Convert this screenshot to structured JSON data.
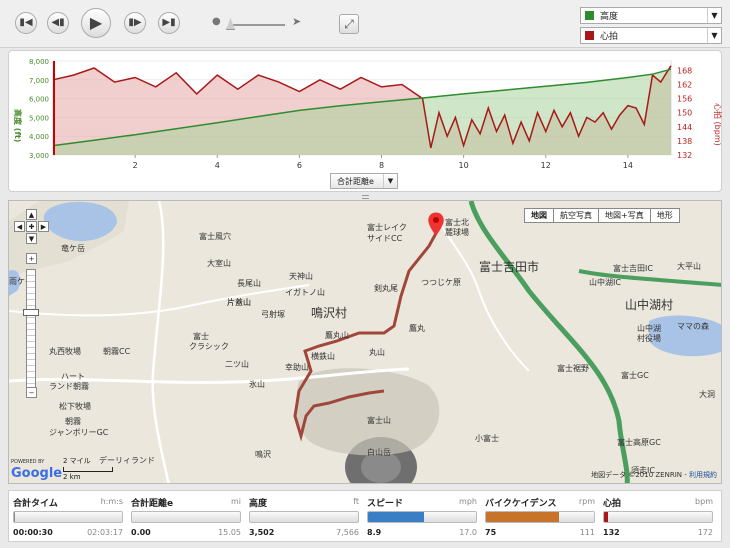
{
  "selectors": {
    "top": {
      "label": "高度",
      "color": "#2e8b2e"
    },
    "bottom": {
      "label": "心拍",
      "color": "#a81818"
    }
  },
  "chart": {
    "distance_selector": "合計距離e",
    "left_axis_label": "高度 (ft)",
    "right_axis_label": "心拍 (bpm)"
  },
  "chart_data": {
    "type": "area",
    "x_ticks": [
      "2",
      "4",
      "6",
      "8",
      "10",
      "12",
      "14"
    ],
    "xlim": [
      0,
      15.05
    ],
    "left_ticks": [
      "8,000",
      "7,000",
      "6,000",
      "5,000",
      "4,000",
      "3,000"
    ],
    "left_ylim": [
      3000,
      8000
    ],
    "right_ticks": [
      "168",
      "162",
      "156",
      "150",
      "144",
      "138",
      "132"
    ],
    "right_ylim": [
      132,
      172
    ],
    "series": [
      {
        "name": "高度",
        "color": "#2e8b2e",
        "x": [
          0,
          1,
          2,
          3,
          4,
          5,
          6,
          7,
          8,
          9,
          10,
          11,
          12,
          13,
          14,
          14.6,
          15.05
        ],
        "values": [
          3502,
          3780,
          4080,
          4400,
          4720,
          5050,
          5370,
          5620,
          5830,
          6030,
          6250,
          6450,
          6660,
          6860,
          7120,
          7300,
          7566
        ]
      },
      {
        "name": "心拍",
        "color": "#a81818",
        "x": [
          0,
          0.5,
          1,
          1.5,
          2,
          2.5,
          3,
          3.5,
          4,
          4.5,
          5,
          5.5,
          6,
          6.5,
          7,
          7.5,
          8,
          8.5,
          9,
          9.2,
          9.4,
          9.6,
          9.8,
          10,
          10.2,
          10.4,
          10.6,
          10.8,
          11,
          11.2,
          11.4,
          11.6,
          11.8,
          12,
          12.2,
          12.4,
          12.6,
          12.8,
          13,
          13.2,
          13.4,
          13.6,
          13.8,
          14,
          14.2,
          14.4,
          14.6,
          14.8,
          15.05
        ],
        "values": [
          164,
          166,
          169,
          163,
          165,
          161,
          167,
          158,
          166,
          160,
          166,
          163,
          159,
          164,
          160,
          165,
          161,
          162,
          156,
          135,
          150,
          140,
          148,
          136,
          147,
          141,
          152,
          142,
          149,
          137,
          146,
          138,
          150,
          142,
          151,
          144,
          150,
          140,
          148,
          146,
          150,
          143,
          149,
          153,
          152,
          145,
          166,
          163,
          170
        ]
      }
    ]
  },
  "map": {
    "types": [
      "地図",
      "航空写真",
      "地図+写真",
      "地形"
    ],
    "big_labels": [
      "鳴沢村",
      "富士吉田市",
      "山中湖村"
    ],
    "labels": [
      "竜ケ岳",
      "雨ケ岳",
      "富士風穴",
      "大室山",
      "長尾山",
      "天神山",
      "イガトノ山",
      "片蓋山",
      "弓射塚",
      "富士レイク",
      "サイドCC",
      "剣丸尾",
      "つつじケ原",
      "富士北",
      "麓球場",
      "富士吉田IC",
      "山中湖IC",
      "大平山",
      "山中湖",
      "村役場",
      "ママの森",
      "富士",
      "クラシック",
      "朝霧CC",
      "丸西牧場",
      "ハート",
      "ランド朝霧",
      "松下牧場",
      "朝霧",
      "ジャンボリーGC",
      "デーリィランド",
      "二ツ山",
      "氷山",
      "幸助山",
      "横鉄山",
      "鷹丸山",
      "丸山",
      "富士山",
      "富士裾野",
      "富士GC",
      "小富士",
      "富士高原GC",
      "白山岳",
      "鷹丸",
      "大洞",
      "須走IC",
      "片蓋山",
      "鳴沢"
    ],
    "scale_mi": "2 マイル",
    "scale_km": "2 km",
    "attribution": "地図データ ©2010 ZENRIN",
    "terms": "利用規約",
    "powered_by": "POWERED BY",
    "google": "Google"
  },
  "stats": [
    {
      "label": "合計タイム",
      "unit": "h:m:s",
      "current": "00:00:30",
      "max": "02:03:17",
      "fill": 0.004,
      "color": "#888"
    },
    {
      "label": "合計距離e",
      "unit": "mi",
      "current": "0.00",
      "max": "15.05",
      "fill": 0.0,
      "color": "#888"
    },
    {
      "label": "高度",
      "unit": "ft",
      "current": "3,502",
      "max": "7,566",
      "fill": 0.0,
      "color": "#888"
    },
    {
      "label": "スピード",
      "unit": "mph",
      "current": "8.9",
      "max": "17.0",
      "fill": 0.52,
      "color": "#3a7fc6"
    },
    {
      "label": "バイクケイデンス",
      "unit": "rpm",
      "current": "75",
      "max": "111",
      "fill": 0.68,
      "color": "#c8732a"
    },
    {
      "label": "心拍",
      "unit": "bpm",
      "current": "132",
      "max": "172",
      "fill": 0.04,
      "color": "#a81818"
    }
  ]
}
